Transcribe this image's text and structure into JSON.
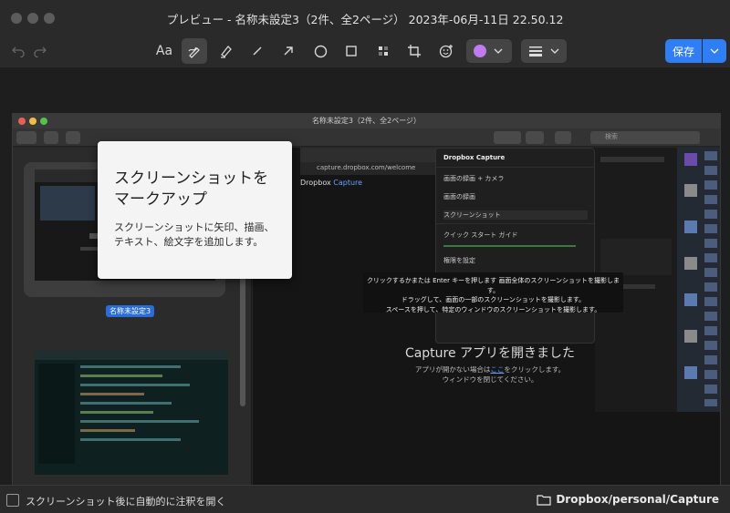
{
  "window": {
    "title": "プレビュー - 名称未設定3（2件、全2ページ） 2023年-06月-11日 22.50.12"
  },
  "toolbar": {
    "undo_icon": "undo-icon",
    "redo_icon": "redo-icon",
    "text_tool_label": "Aa",
    "save_label": "保存",
    "color_swatch": "#c07bf2",
    "accent": "#2f7ef6"
  },
  "popover": {
    "title": "スクリーンショットを\nマークアップ",
    "body": "スクリーンショットに矢印、描画、\nテキスト、絵文字を追加します。"
  },
  "screenshot": {
    "preview_title": "名称未設定3（2件、全2ページ）",
    "search_placeholder": "検索",
    "thumb_label": "名称未設定3",
    "address": "capture.dropbox.com/welcome",
    "dropbox_brand": "Dropbox",
    "dropbox_product": "Capture",
    "menu": [
      "画面の録画 + カメラ",
      "画面の録画",
      "スクリーンショット",
      "クイック スタート ガイド",
      "権限を設定"
    ],
    "capture_heading": "Capture アプリを開きました",
    "capture_sub": "アプリが開かない場合は",
    "capture_link": "ここ",
    "capture_sub2": "をクリックします。",
    "capture_sub3": "ウィンドウを閉じてください。",
    "hint_line1": "クリックするかまたは Enter キーを押します 画面全体のスクリーンショットを撮影します。",
    "hint_line2": "ドラッグして、画面の一部のスクリーンショットを撮影します。",
    "hint_line3": "スペースを押して、特定のウィンドウのスクリーンショットを撮影します。"
  },
  "status": {
    "checkbox_label": "スクリーンショット後に自動的に注釈を開く",
    "folder_path": "Dropbox/personal/Capture"
  }
}
